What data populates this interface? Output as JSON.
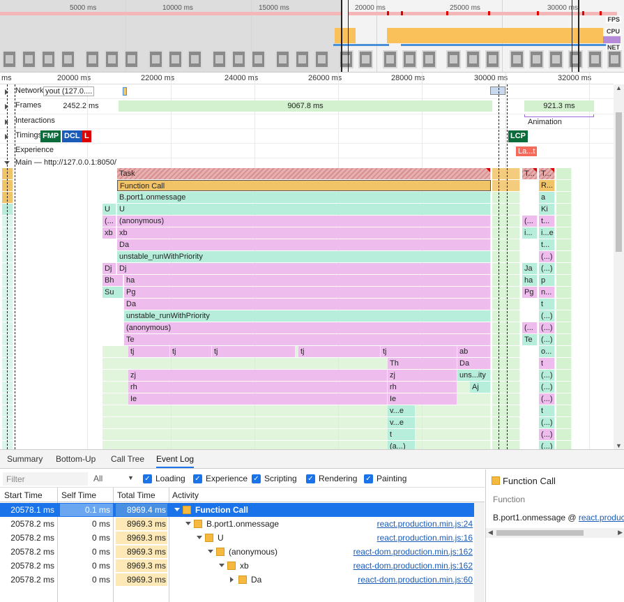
{
  "overview": {
    "ticks": [
      "5000 ms",
      "10000 ms",
      "15000 ms",
      "20000 ms",
      "25000 ms",
      "30000 ms"
    ],
    "labels": {
      "fps": "FPS",
      "cpu": "CPU",
      "net": "NET"
    }
  },
  "ruler": {
    "first": "ms",
    "ticks": [
      "20000 ms",
      "22000 ms",
      "24000 ms",
      "26000 ms",
      "28000 ms",
      "30000 ms",
      "32000 ms"
    ]
  },
  "tracks": {
    "network": "Network",
    "network_extra": "yout (127.0....",
    "frames": "Frames",
    "frames_values": [
      "2452.2 ms",
      "9067.8 ms",
      "921.3 ms"
    ],
    "interactions": "Interactions",
    "animation": "Animation",
    "timings": "Timings",
    "timing_badges": [
      "FMP",
      "DCL",
      "L",
      "LCP"
    ],
    "experience": "Experience",
    "experience_item": "La...t",
    "main": "Main — http://127.0.0.1:8050/"
  },
  "flame": {
    "rows": [
      [
        "Task"
      ],
      [
        "Function Call"
      ],
      [
        "B.port1.onmessage"
      ],
      [
        "U",
        "U"
      ],
      [
        "(...",
        "(anonymous)"
      ],
      [
        "xb",
        "xb"
      ],
      [
        "Da"
      ],
      [
        "unstable_runWithPriority"
      ],
      [
        "Dj",
        "Dj"
      ],
      [
        "Bh",
        "ha"
      ],
      [
        "Su",
        "Pg"
      ],
      [
        "Da"
      ],
      [
        "unstable_runWithPriority"
      ],
      [
        "(anonymous)"
      ],
      [
        "Te"
      ],
      [
        "tj",
        "tj",
        "tj",
        "tj",
        "tj",
        "ab"
      ],
      [
        "Th",
        "Da"
      ],
      [
        "zj",
        "zj",
        "uns...ity"
      ],
      [
        "rh",
        "rh",
        "Aj"
      ],
      [
        "Ie",
        "Ie"
      ],
      [
        "v...e"
      ],
      [
        "v...e"
      ],
      [
        "t"
      ],
      [
        "(a...)"
      ]
    ],
    "right_cols": [
      [
        "T...",
        "T..."
      ],
      [
        "R..."
      ],
      [
        "a"
      ],
      [
        "Ki"
      ],
      [
        "(...",
        "t..."
      ],
      [
        "i...",
        "i...e"
      ],
      [
        "t..."
      ],
      [
        "(...)"
      ],
      [
        "Ja",
        "(...)"
      ],
      [
        "ha",
        "p"
      ],
      [
        "Pg",
        "n..."
      ],
      [
        "t"
      ],
      [
        "(...)"
      ],
      [
        "(...",
        "(...)"
      ],
      [
        "Te",
        "(...)"
      ],
      [
        "o..."
      ],
      [
        "t"
      ],
      [
        "(...)"
      ],
      [
        "(...)"
      ],
      [
        "(...)"
      ],
      [
        "t"
      ],
      [
        "(...)"
      ],
      [
        "(...)"
      ],
      [
        "(...)"
      ]
    ]
  },
  "tabs": [
    "Summary",
    "Bottom-Up",
    "Call Tree",
    "Event Log"
  ],
  "filter": {
    "placeholder": "Filter",
    "all": "All",
    "checks": [
      "Loading",
      "Experience",
      "Scripting",
      "Rendering",
      "Painting"
    ]
  },
  "table": {
    "headers": [
      "Start Time",
      "Self Time",
      "Total Time",
      "Activity"
    ],
    "rows": [
      {
        "start": "20578.1 ms",
        "self": "0.1 ms",
        "total": "8969.4 ms",
        "activity": "Function Call",
        "link": ""
      },
      {
        "start": "20578.2 ms",
        "self": "0 ms",
        "total": "8969.3 ms",
        "activity": "B.port1.onmessage",
        "link": "react.production.min.js:24"
      },
      {
        "start": "20578.2 ms",
        "self": "0 ms",
        "total": "8969.3 ms",
        "activity": "U",
        "link": "react.production.min.js:16"
      },
      {
        "start": "20578.2 ms",
        "self": "0 ms",
        "total": "8969.3 ms",
        "activity": "(anonymous)",
        "link": "react-dom.production.min.js:162"
      },
      {
        "start": "20578.2 ms",
        "self": "0 ms",
        "total": "8969.3 ms",
        "activity": "xb",
        "link": "react-dom.production.min.js:162"
      },
      {
        "start": "20578.2 ms",
        "self": "0 ms",
        "total": "8969.3 ms",
        "activity": "Da",
        "link": "react-dom.production.min.js:60"
      }
    ]
  },
  "details": {
    "title": "Function Call",
    "sub": "Function",
    "line_prefix": "B.port1.onmessage @ ",
    "line_link": "react.production"
  },
  "colors": {
    "accent": "#1a73e8",
    "function_call": "#f2c468",
    "scripting_green": "#b6eedb",
    "scripting_pink": "#eebdee",
    "task_red": "#d98f8f"
  }
}
